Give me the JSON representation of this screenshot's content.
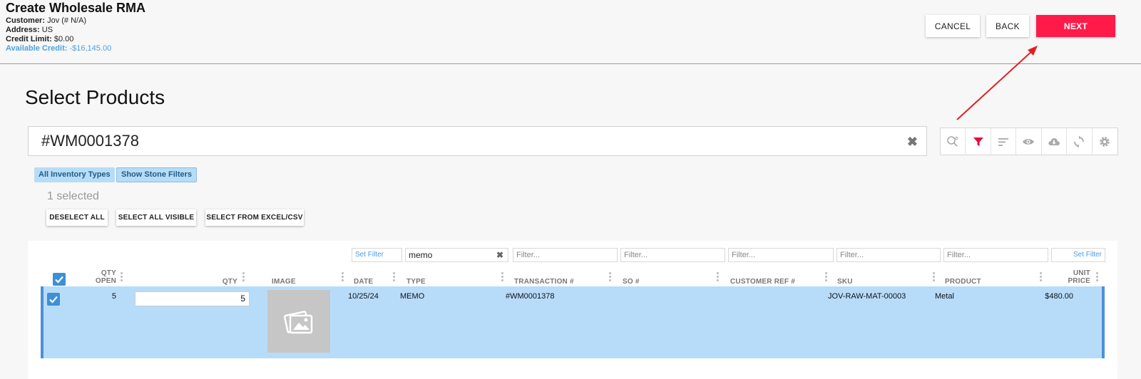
{
  "header": {
    "title": "Create Wholesale RMA",
    "customer_label": "Customer:",
    "customer_value": "Jov (# N/A)",
    "address_label": "Address:",
    "address_value": "US",
    "credit_limit_label": "Credit Limit:",
    "credit_limit_value": "$0.00",
    "available_credit_label": "Available Credit:",
    "available_credit_value": "-$16,145.00",
    "buttons": {
      "cancel": "CANCEL",
      "back": "BACK",
      "next": "NEXT"
    }
  },
  "section_title": "Select Products",
  "search": {
    "value": "#WM0001378"
  },
  "toolbar": {
    "icons": [
      "search-options-icon",
      "filter-icon",
      "sort-icon",
      "eye-icon",
      "cloud-download-icon",
      "refresh-icon",
      "gear-icon"
    ]
  },
  "chips": {
    "inventory_types": "All Inventory Types",
    "stone_filters": "Show Stone Filters"
  },
  "selection": {
    "count_text": "1 selected",
    "deselect_all": "DESELECT ALL",
    "select_all_visible": "SELECT ALL VISIBLE",
    "select_from_excel": "SELECT FROM EXCEL/CSV"
  },
  "grid": {
    "filters": {
      "set_filter_left": "Set Filter",
      "type_value": "memo",
      "placeholder": "Filter...",
      "set_filter_right": "Set Filter"
    },
    "headers": {
      "qty_open_1": "QTY",
      "qty_open_2": "OPEN",
      "qty": "QTY",
      "image": "IMAGE",
      "date": "DATE",
      "type": "TYPE",
      "transaction": "TRANSACTION #",
      "so": "SO #",
      "customer_ref": "CUSTOMER REF #",
      "sku": "SKU",
      "product": "PRODUCT",
      "unit_price_1": "UNIT",
      "unit_price_2": "PRICE"
    },
    "rows": [
      {
        "qty_open": "5",
        "qty": "5",
        "date": "10/25/24",
        "type": "MEMO",
        "transaction": "#WM0001378",
        "so": "",
        "customer_ref": "",
        "sku": "JOV-RAW-MAT-00003",
        "product": "Metal",
        "unit_price": "$480.00"
      }
    ]
  },
  "colors": {
    "accent": "#ff1a4a",
    "selection": "#b7dcfa",
    "link": "#4aa3e0",
    "checkbox": "#3d8fd6"
  }
}
